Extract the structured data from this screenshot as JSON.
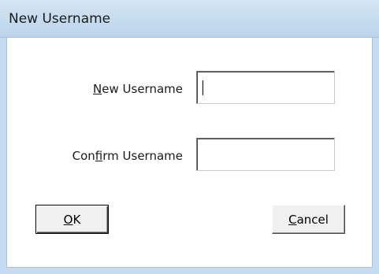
{
  "window": {
    "title": "New Username"
  },
  "form": {
    "new_username": {
      "label_pre": "",
      "label_mnemonic": "N",
      "label_post": "ew Username",
      "value": ""
    },
    "confirm_username": {
      "label_pre": "Con",
      "label_mnemonic": "f",
      "label_post": "irm Username",
      "value": ""
    }
  },
  "buttons": {
    "ok": {
      "label_mnemonic": "O",
      "label_post": "K"
    },
    "cancel": {
      "label_mnemonic": "C",
      "label_post": "ancel"
    }
  },
  "colors": {
    "titlebar": "#c5dbef",
    "client_background": "#ffffff",
    "button_face": "#f0f0f0"
  }
}
